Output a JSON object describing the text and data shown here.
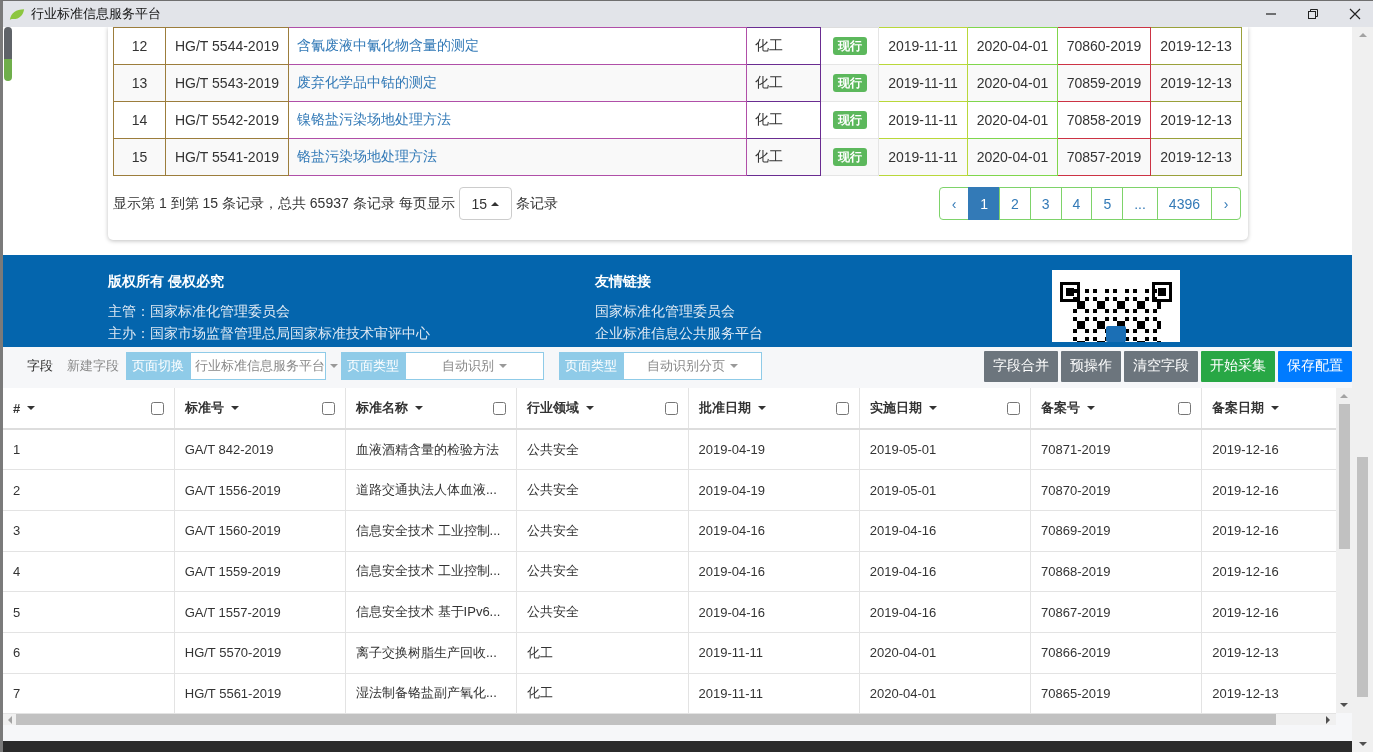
{
  "window": {
    "title": "行业标准信息服务平台"
  },
  "results_table": {
    "rows": [
      {
        "index": "12",
        "code": "HG/T 5544-2019",
        "name": "含氰废液中氰化物含量的测定",
        "industry": "化工",
        "status": "现行",
        "approved": "2019-11-11",
        "effective": "2020-04-01",
        "record_no": "70860-2019",
        "record_date": "2019-12-13"
      },
      {
        "index": "13",
        "code": "HG/T 5543-2019",
        "name": "废弃化学品中钴的测定",
        "industry": "化工",
        "status": "现行",
        "approved": "2019-11-11",
        "effective": "2020-04-01",
        "record_no": "70859-2019",
        "record_date": "2019-12-13"
      },
      {
        "index": "14",
        "code": "HG/T 5542-2019",
        "name": "镍铬盐污染场地处理方法",
        "industry": "化工",
        "status": "现行",
        "approved": "2019-11-11",
        "effective": "2020-04-01",
        "record_no": "70858-2019",
        "record_date": "2019-12-13"
      },
      {
        "index": "15",
        "code": "HG/T 5541-2019",
        "name": "铬盐污染场地处理方法",
        "industry": "化工",
        "status": "现行",
        "approved": "2019-11-11",
        "effective": "2020-04-01",
        "record_no": "70857-2019",
        "record_date": "2019-12-13"
      }
    ]
  },
  "pagination": {
    "summary": "显示第 1 到第 15 条记录，总共 65937 条记录 每页显示",
    "page_size": "15",
    "summary_end": "条记录",
    "prev": "‹",
    "next": "›",
    "pages": [
      {
        "label": "1",
        "selected": true
      },
      {
        "label": "2",
        "selected": false
      },
      {
        "label": "3",
        "selected": false
      },
      {
        "label": "4",
        "selected": false
      },
      {
        "label": "5",
        "selected": false
      },
      {
        "label": "...",
        "selected": false
      },
      {
        "label": "4396",
        "selected": false
      }
    ]
  },
  "footer": {
    "sections": [
      {
        "heading": "版权所有 侵权必究",
        "lines": [
          "主管：国家标准化管理委员会",
          "主办：国家市场监督管理总局国家标准技术审评中心"
        ]
      },
      {
        "heading": "友情链接",
        "lines": [
          "国家标准化管理委员会",
          "企业标准信息公共服务平台"
        ]
      }
    ]
  },
  "toolbar": {
    "label": "字段",
    "new_field": "新建字段",
    "selects": [
      {
        "label": "页面切换",
        "value": "行业标准信息服务平台"
      },
      {
        "label": "页面类型",
        "value": "自动识别"
      },
      {
        "label": "页面类型",
        "value": "自动识别分页"
      }
    ],
    "buttons": [
      {
        "label": "字段合并",
        "kind": "secondary"
      },
      {
        "label": "预操作",
        "kind": "secondary"
      },
      {
        "label": "清空字段",
        "kind": "secondary"
      },
      {
        "label": "开始采集",
        "kind": "success"
      },
      {
        "label": "保存配置",
        "kind": "primary"
      }
    ]
  },
  "fields_table": {
    "columns": [
      {
        "label": "#",
        "checked": false
      },
      {
        "label": "标准号",
        "checked": false
      },
      {
        "label": "标准名称",
        "checked": false
      },
      {
        "label": "行业领域",
        "checked": false
      },
      {
        "label": "批准日期",
        "checked": false
      },
      {
        "label": "实施日期",
        "checked": false
      },
      {
        "label": "备案号",
        "checked": false
      },
      {
        "label": "备案日期"
      }
    ],
    "rows": [
      [
        "1",
        "GA/T 842-2019",
        "血液酒精含量的检验方法",
        "公共安全",
        "2019-04-19",
        "2019-05-01",
        "70871-2019",
        "2019-12-16"
      ],
      [
        "2",
        "GA/T 1556-2019",
        "道路交通执法人体血液...",
        "公共安全",
        "2019-04-19",
        "2019-05-01",
        "70870-2019",
        "2019-12-16"
      ],
      [
        "3",
        "GA/T 1560-2019",
        "信息安全技术 工业控制...",
        "公共安全",
        "2019-04-16",
        "2019-04-16",
        "70869-2019",
        "2019-12-16"
      ],
      [
        "4",
        "GA/T 1559-2019",
        "信息安全技术 工业控制...",
        "公共安全",
        "2019-04-16",
        "2019-04-16",
        "70868-2019",
        "2019-12-16"
      ],
      [
        "5",
        "GA/T 1557-2019",
        "信息安全技术 基于IPv6...",
        "公共安全",
        "2019-04-16",
        "2019-04-16",
        "70867-2019",
        "2019-12-16"
      ],
      [
        "6",
        "HG/T 5570-2019",
        "离子交换树脂生产回收...",
        "化工",
        "2019-11-11",
        "2020-04-01",
        "70866-2019",
        "2019-12-13"
      ],
      [
        "7",
        "HG/T 5561-2019",
        "湿法制备铬盐副产氧化...",
        "化工",
        "2019-11-11",
        "2020-04-01",
        "70865-2019",
        "2019-12-13"
      ]
    ]
  }
}
